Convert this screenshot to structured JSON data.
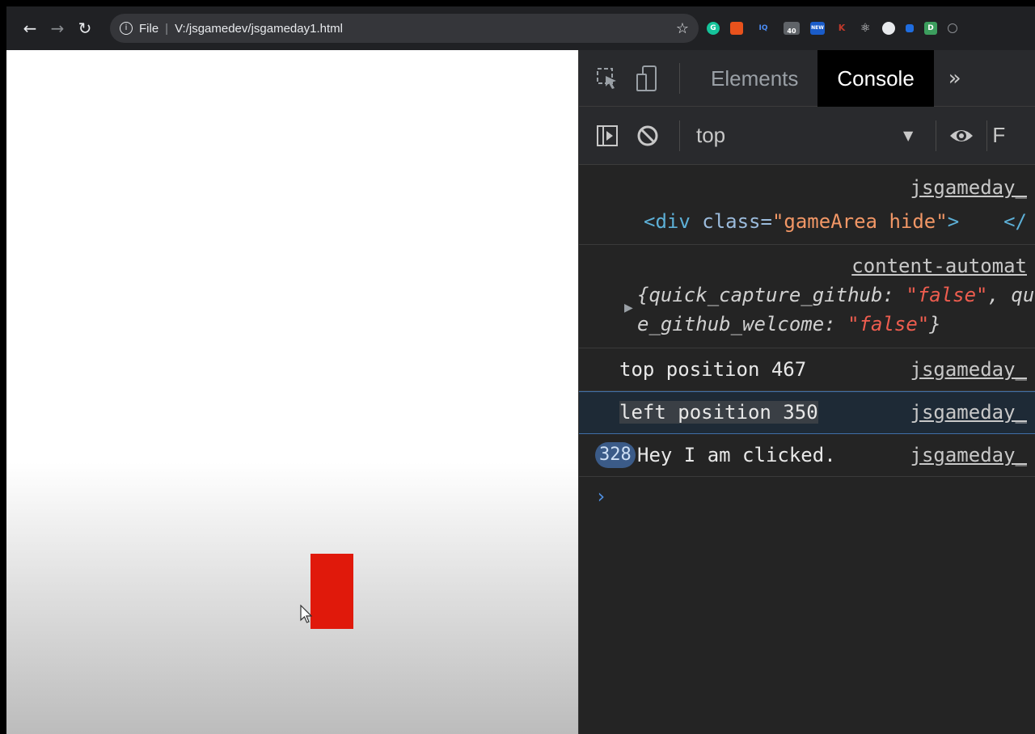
{
  "browser": {
    "scheme_label": "File",
    "url": "V:/jsgamedev/jsgameday1.html",
    "extension_badge": "40",
    "extension_new": "NEW",
    "extension_iq": "IQ"
  },
  "page": {
    "box_color": "#e0190b"
  },
  "devtools": {
    "tabs": {
      "elements": "Elements",
      "console": "Console"
    },
    "context": "top",
    "messages": [
      {
        "source": "jsgameday_",
        "line1_open": "<div ",
        "attr": "class=",
        "attr_value": "\"gameArea hide\"",
        "line1_close": ">",
        "end_tag": "</"
      },
      {
        "source": "content-automat",
        "line1": "{quick_capture_github: ",
        "val1": "\"false\"",
        "line1_tail": ", qu",
        "line2": "e_github_welcome: ",
        "val2": "\"false\"",
        "line2_close": "}"
      },
      {
        "source": "jsgameday_",
        "text": "top position 467"
      },
      {
        "source": "jsgameday_",
        "text_highlight": "left position 350"
      },
      {
        "source": "jsgameday_",
        "count": "328",
        "text": " Hey I am clicked."
      }
    ]
  }
}
